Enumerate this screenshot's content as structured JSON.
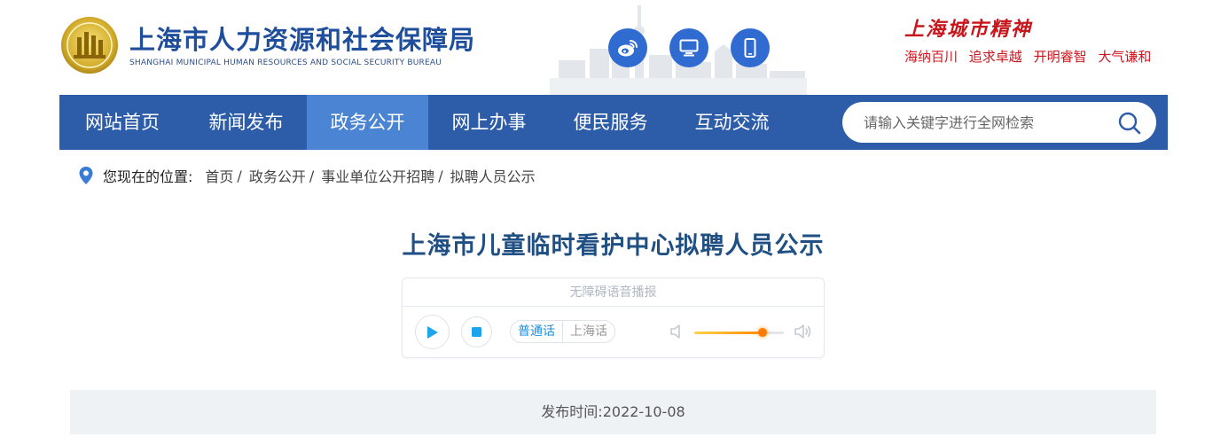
{
  "header": {
    "site_title": "上海市人力资源和社会保障局",
    "site_subtitle": "SHANGHAI MUNICIPAL HUMAN RESOURCES AND SOCIAL SECURITY BUREAU",
    "icons": [
      "weibo-icon",
      "monitor-icon",
      "mobile-icon"
    ],
    "spirit_title": "上海城市精神",
    "spirit_words": [
      "海纳百川",
      "追求卓越",
      "开明睿智",
      "大气谦和"
    ]
  },
  "nav": {
    "items": [
      {
        "label": "网站首页"
      },
      {
        "label": "新闻发布"
      },
      {
        "label": "政务公开"
      },
      {
        "label": "网上办事"
      },
      {
        "label": "便民服务"
      },
      {
        "label": "互动交流"
      }
    ],
    "active": "政务公开",
    "search": {
      "placeholder": "请输入关键字进行全网检索",
      "value": ""
    }
  },
  "breadcrumb": {
    "label": "您现在的位置:",
    "items": [
      "首页",
      "政务公开",
      "事业单位公开招聘",
      "拟聘人员公示"
    ],
    "separator": "/"
  },
  "article": {
    "title": "上海市儿童临时看护中心拟聘人员公示",
    "player": {
      "heading": "无障碍语音播报",
      "languages": [
        "普通话",
        "上海话"
      ],
      "selected_language": "普通话",
      "volume": 0.76
    },
    "publish_label": "发布时间:",
    "publish_date": "2022-10-08"
  },
  "colors": {
    "brand_blue": "#2d5ca8",
    "nav_active": "#4a84d2",
    "title_blue": "#1f4f83",
    "spirit_red": "#c8161d",
    "icon_blue": "#2f6bd0"
  }
}
